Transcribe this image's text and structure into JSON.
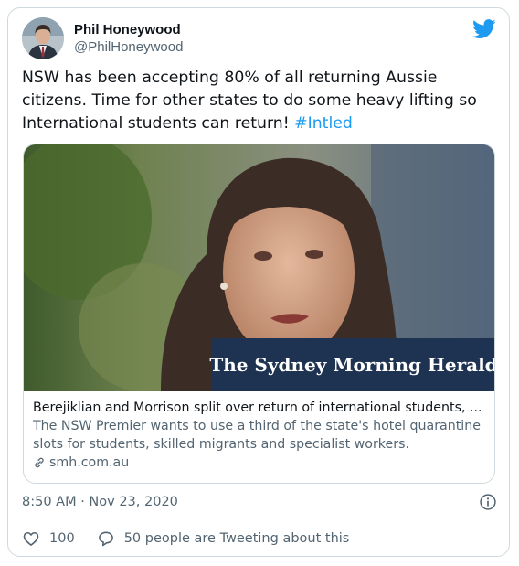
{
  "author": {
    "display_name": "Phil Honeywood",
    "handle": "@PhilHoneywood",
    "avatar_icon": "person-avatar"
  },
  "tweet": {
    "text": "NSW has been accepting 80% of all returning Aussie citizens. Time for other states to do some heavy lifting so International students can return! ",
    "hashtag": "#Intled"
  },
  "card": {
    "masthead": "The Sydney Morning Herald",
    "title": "Berejiklian and Morrison split over return of international students, ...",
    "description": "The NSW Premier wants to use a third of the state's hotel quarantine slots for students, skilled migrants and specialist workers.",
    "domain": "smh.com.au"
  },
  "meta": {
    "timestamp": "8:50 AM · Nov 23, 2020"
  },
  "actions": {
    "like_count": "100",
    "conversation_label": "50 people are Tweeting about this"
  },
  "colors": {
    "brand": "#1d9bf0",
    "text": "#0f1419",
    "muted": "#536471",
    "border": "#cfd9de"
  }
}
